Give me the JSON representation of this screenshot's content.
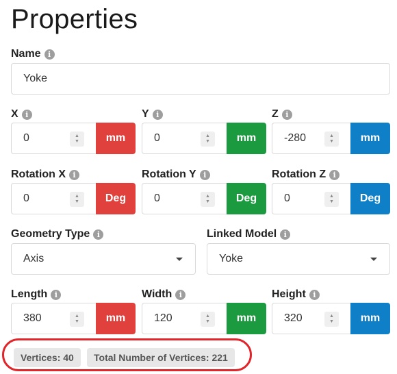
{
  "title": "Properties",
  "name": {
    "label": "Name",
    "value": "Yoke"
  },
  "position": [
    {
      "label": "X",
      "value": "0",
      "unit": "mm"
    },
    {
      "label": "Y",
      "value": "0",
      "unit": "mm"
    },
    {
      "label": "Z",
      "value": "-280",
      "unit": "mm"
    }
  ],
  "rotation": [
    {
      "label": "Rotation X",
      "value": "0",
      "unit": "Deg"
    },
    {
      "label": "Rotation Y",
      "value": "0",
      "unit": "Deg"
    },
    {
      "label": "Rotation Z",
      "value": "0",
      "unit": "Deg"
    }
  ],
  "geometry_type": {
    "label": "Geometry Type",
    "value": "Axis"
  },
  "linked_model": {
    "label": "Linked Model",
    "value": "Yoke"
  },
  "dimensions": [
    {
      "label": "Length",
      "value": "380",
      "unit": "mm"
    },
    {
      "label": "Width",
      "value": "120",
      "unit": "mm"
    },
    {
      "label": "Height",
      "value": "320",
      "unit": "mm"
    }
  ],
  "stats": {
    "vertices": "Vertices: 40",
    "total_vertices": "Total Number of Vertices: 221"
  },
  "colors": {
    "x_axis": "#e0413d",
    "y_axis": "#1c9a3f",
    "z_axis": "#0f80c8",
    "highlight": "#e0262b"
  }
}
